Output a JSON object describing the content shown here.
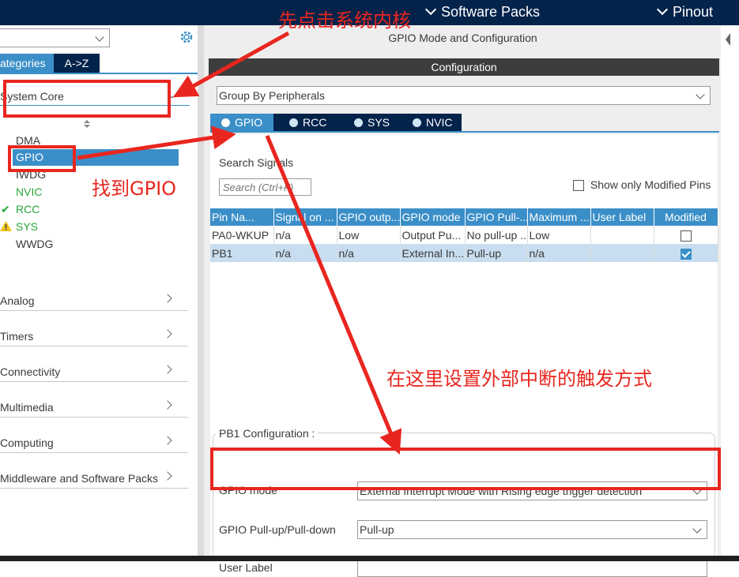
{
  "topbar": {
    "software_packs": "Software Packs",
    "pinout": "Pinout"
  },
  "left": {
    "tabs": [
      "ategories",
      "A->Z"
    ],
    "category_selected": "System Core",
    "sort_icon": "sort-icon",
    "tree": [
      {
        "label": "DMA",
        "color": "#3a3a3a"
      },
      {
        "label": "GPIO",
        "color": "#ffffff"
      },
      {
        "label": "IWDG",
        "color": "#3a3a3a"
      },
      {
        "label": "NVIC",
        "color": "#27a83a"
      },
      {
        "label": "RCC",
        "color": "#27a83a"
      },
      {
        "label": "SYS",
        "color": "#27a83a"
      },
      {
        "label": "WWDG",
        "color": "#3a3a3a"
      }
    ],
    "categories": [
      "Analog",
      "Timers",
      "Connectivity",
      "Multimedia",
      "Computing",
      "Middleware and Software Packs"
    ]
  },
  "right": {
    "title": "GPIO Mode and Configuration",
    "section": "Configuration",
    "group_by": "Group By Peripherals",
    "tabs": [
      "GPIO",
      "RCC",
      "SYS",
      "NVIC"
    ],
    "search_label": "Search Signals",
    "search_placeholder": "Search (Ctrl+F)",
    "show_modified": "Show only Modified Pins",
    "table": {
      "headers": [
        "Pin Na...",
        "Signal on ...",
        "GPIO outp...",
        "GPIO mode",
        "GPIO Pull-...",
        "Maximum ...",
        "User Label",
        "Modified"
      ],
      "rows": [
        [
          "PA0-WKUP",
          "n/a",
          "Low",
          "Output Pu...",
          "No pull-up ...",
          "Low",
          "",
          false
        ],
        [
          "PB1",
          "n/a",
          "n/a",
          "External In...",
          "Pull-up",
          "n/a",
          "",
          true
        ]
      ]
    },
    "pb1_config": "PB1 Configuration :",
    "fields": {
      "gpio_mode_label": "GPIO mode",
      "gpio_mode_value": "External Interrupt Mode with Rising edge trigger detection",
      "pull_label": "GPIO Pull-up/Pull-down",
      "pull_value": "Pull-up",
      "user_label": "User Label"
    }
  },
  "annotations": {
    "a1": "先点击系统内核",
    "a2": "找到GPIO",
    "a3": "在这里设置外部中断的触发方式"
  },
  "colors": {
    "accent": "#3b8fc8",
    "dark": "#03234b",
    "annotation": "#e8261f",
    "ok": "#27a83a"
  }
}
